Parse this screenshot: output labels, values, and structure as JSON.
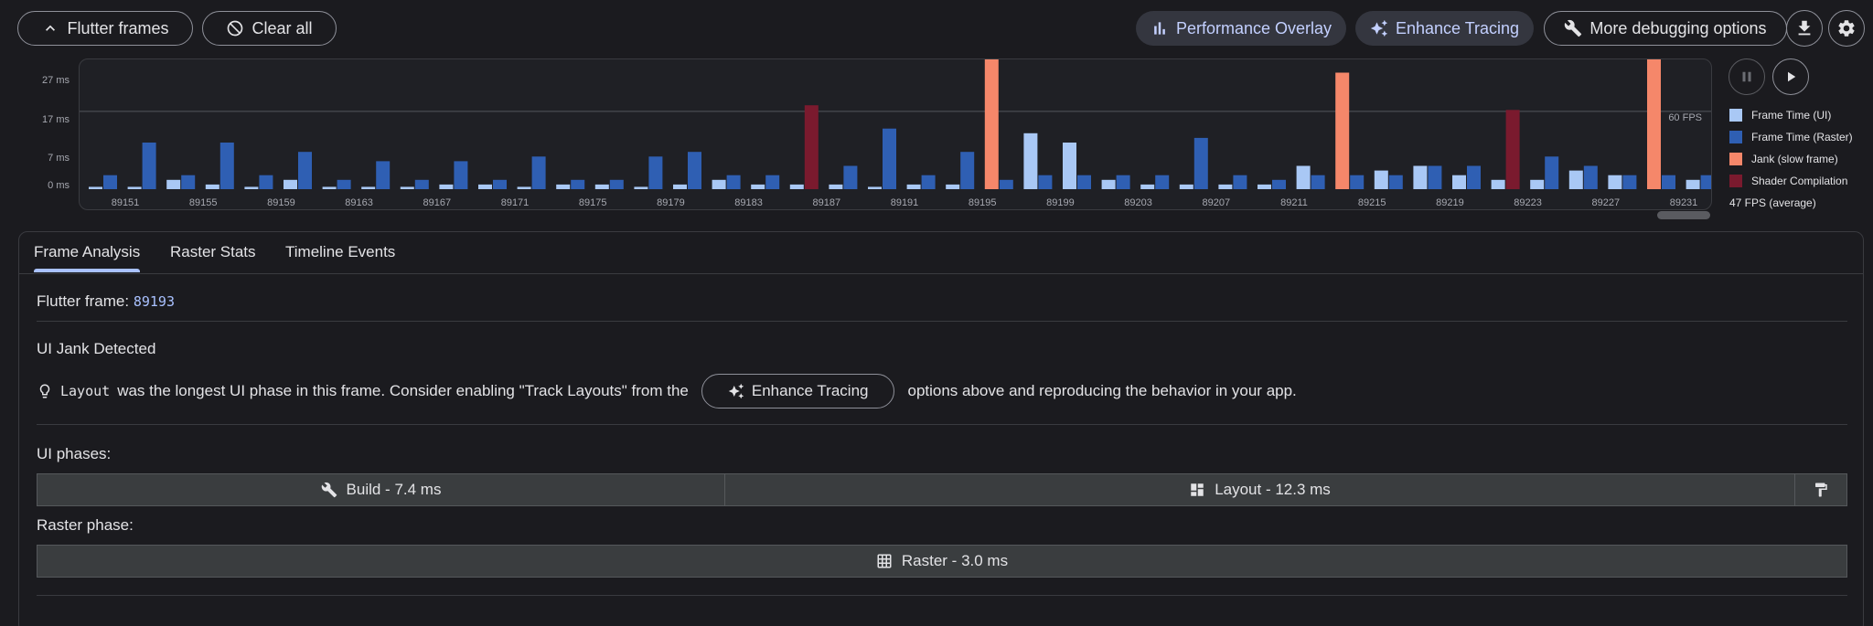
{
  "toolbar": {
    "flutter_frames": "Flutter frames",
    "clear_all": "Clear all",
    "performance_overlay": "Performance Overlay",
    "enhance_tracing": "Enhance Tracing",
    "more_debugging": "More debugging options"
  },
  "chart_data": {
    "type": "bar",
    "y_ticks": [
      "27 ms",
      "17 ms",
      "7 ms",
      "0 ms"
    ],
    "fps_line_label": "60 FPS",
    "x_tick_labels": [
      "89151",
      "89155",
      "89159",
      "89163",
      "89167",
      "89171",
      "89175",
      "89179",
      "89183",
      "89187",
      "89191",
      "89195",
      "89199",
      "89203",
      "89207",
      "89211",
      "89215",
      "89219",
      "89223",
      "89227",
      "89231"
    ],
    "selected_frame": 89193,
    "series": [
      {
        "name": "Frame Time (UI)",
        "color": "#a9c8f5"
      },
      {
        "name": "Frame Time (Raster)",
        "color": "#2f5fb3"
      },
      {
        "name": "Jank (slow frame)",
        "color": "#f5876a"
      },
      {
        "name": "Shader Compilation",
        "color": "#7a1a2e"
      }
    ],
    "frames": [
      {
        "id": 89150,
        "ui": 0.5,
        "raster": 3.0
      },
      {
        "id": 89151,
        "ui": 0.5,
        "raster": 10.0
      },
      {
        "id": 89152,
        "ui": 2.0,
        "raster": 3.0
      },
      {
        "id": 89153,
        "ui": 1.0,
        "raster": 10.0
      },
      {
        "id": 89154,
        "ui": 0.5,
        "raster": 3.0
      },
      {
        "id": 89155,
        "ui": 2.0,
        "raster": 8.0
      },
      {
        "id": 89156,
        "ui": 0.5,
        "raster": 2.0
      },
      {
        "id": 89157,
        "ui": 0.5,
        "raster": 6.0
      },
      {
        "id": 89158,
        "ui": 0.5,
        "raster": 2.0
      },
      {
        "id": 89159,
        "ui": 1.0,
        "raster": 6.0
      },
      {
        "id": 89160,
        "ui": 1.0,
        "raster": 2.0
      },
      {
        "id": 89161,
        "ui": 0.5,
        "raster": 7.0
      },
      {
        "id": 89162,
        "ui": 1.0,
        "raster": 2.0
      },
      {
        "id": 89163,
        "ui": 1.0,
        "raster": 2.0
      },
      {
        "id": 89164,
        "ui": 0.5,
        "raster": 7.0
      },
      {
        "id": 89165,
        "ui": 1.0,
        "raster": 8.0
      },
      {
        "id": 89166,
        "ui": 2.0,
        "raster": 3.0
      },
      {
        "id": 89167,
        "ui": 1.0,
        "raster": 3.0
      },
      {
        "id": 89168,
        "ui": 1.0,
        "raster": 18.0,
        "jank": true,
        "shader": true
      },
      {
        "id": 89169,
        "ui": 1.0,
        "raster": 5.0
      },
      {
        "id": 89170,
        "ui": 0.5,
        "raster": 13.0
      },
      {
        "id": 89171,
        "ui": 1.0,
        "raster": 3.0
      },
      {
        "id": 89172,
        "ui": 1.0,
        "raster": 8.0
      },
      {
        "id": 89173,
        "ui": 33.0,
        "raster": 2.0,
        "jank": true
      },
      {
        "id": 89174,
        "ui": 12.0,
        "raster": 3.0
      },
      {
        "id": 89175,
        "ui": 10.0,
        "raster": 3.0
      },
      {
        "id": 89176,
        "ui": 2.0,
        "raster": 3.0
      },
      {
        "id": 89177,
        "ui": 1.0,
        "raster": 3.0
      },
      {
        "id": 89178,
        "ui": 1.0,
        "raster": 11.0
      },
      {
        "id": 89179,
        "ui": 1.0,
        "raster": 3.0
      },
      {
        "id": 89180,
        "ui": 1.0,
        "raster": 2.0
      },
      {
        "id": 89181,
        "ui": 5.0,
        "raster": 3.0
      },
      {
        "id": 89182,
        "ui": 25.0,
        "raster": 3.0,
        "jank": true
      },
      {
        "id": 89183,
        "ui": 4.0,
        "raster": 3.0
      },
      {
        "id": 89184,
        "ui": 5.0,
        "raster": 5.0
      },
      {
        "id": 89185,
        "ui": 3.0,
        "raster": 5.0
      },
      {
        "id": 89186,
        "ui": 2.0,
        "raster": 17.0,
        "jank": true,
        "shader": true
      },
      {
        "id": 89187,
        "ui": 2.0,
        "raster": 7.0
      },
      {
        "id": 89188,
        "ui": 4.0,
        "raster": 5.0
      },
      {
        "id": 89189,
        "ui": 3.0,
        "raster": 3.0
      },
      {
        "id": 89190,
        "ui": 33.0,
        "raster": 3.0,
        "jank": true
      },
      {
        "id": 89191,
        "ui": 2.0,
        "raster": 3.0
      },
      {
        "id": 89192,
        "ui": 1.0,
        "raster": 3.0
      }
    ]
  },
  "controls": {
    "pause_icon": "pause-icon",
    "play_icon": "play-icon"
  },
  "legend": [
    {
      "label": "Frame Time (UI)",
      "color": "#a9c8f5"
    },
    {
      "label": "Frame Time (Raster)",
      "color": "#2f5fb3"
    },
    {
      "label": "Jank (slow frame)",
      "color": "#f5876a"
    },
    {
      "label": "Shader Compilation",
      "color": "#7a1a2e"
    }
  ],
  "fps_average": "47 FPS (average)",
  "tabs": [
    "Frame Analysis",
    "Raster Stats",
    "Timeline Events"
  ],
  "analysis": {
    "frame_label": "Flutter frame:",
    "frame_number": "89193",
    "jank_title": "UI Jank Detected",
    "hint_code": "Layout",
    "hint_text_1": "was the longest UI phase in this frame. Consider enabling \"Track Layouts\" from the",
    "hint_button": "Enhance Tracing",
    "hint_text_2": "options above and reproducing the behavior in your app.",
    "ui_phases_label": "UI phases:",
    "build_label": "Build - 7.4 ms",
    "layout_label": "Layout - 12.3 ms",
    "raster_phase_label": "Raster phase:",
    "raster_label": "Raster - 3.0 ms"
  }
}
